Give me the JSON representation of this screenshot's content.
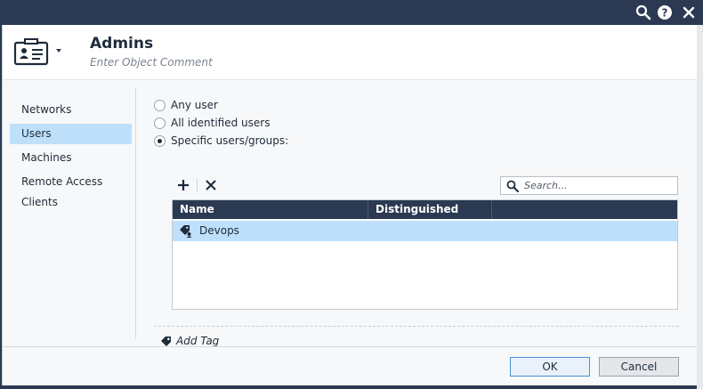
{
  "object": {
    "name": "Admins",
    "comment_placeholder": "Enter Object Comment"
  },
  "sidebar": {
    "items": [
      {
        "label": "Networks",
        "active": false
      },
      {
        "label": "Users",
        "active": true
      },
      {
        "label": "Machines",
        "active": false
      },
      {
        "label": "Remote Access Clients",
        "active": false
      }
    ]
  },
  "user_scope": {
    "options": [
      {
        "label": "Any user",
        "selected": false
      },
      {
        "label": "All identified users",
        "selected": false
      },
      {
        "label": "Specific users/groups:",
        "selected": true
      }
    ]
  },
  "search": {
    "placeholder": "Search..."
  },
  "table": {
    "columns": [
      "Name",
      "Distinguished Name"
    ],
    "rows": [
      {
        "name": "Devops",
        "distinguished_name": "",
        "icon": "user-group-tag-icon"
      }
    ]
  },
  "add_tag_label": "Add Tag",
  "footer": {
    "ok_label": "OK",
    "cancel_label": "Cancel"
  },
  "colors": {
    "title_bar": "#2b3a52",
    "selection": "#bee0fa",
    "table_header": "#2b3a52",
    "ok_border": "#4a90d9"
  }
}
